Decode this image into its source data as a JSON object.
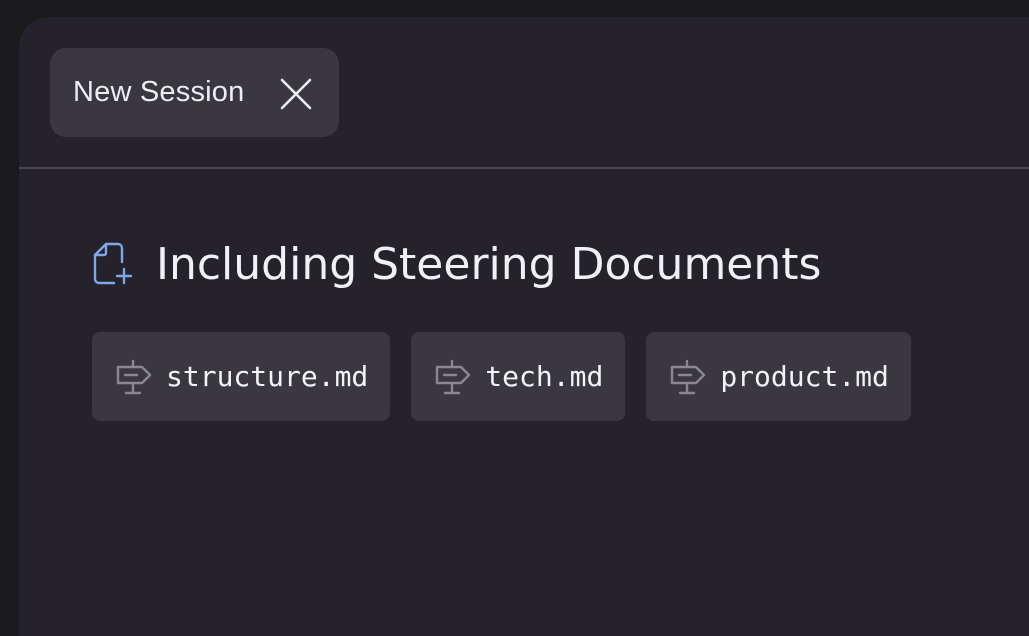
{
  "tab": {
    "label": "New Session",
    "close_icon": "close-icon"
  },
  "section": {
    "title": "Including Steering Documents",
    "icon": "file-add-icon",
    "icon_color": "#7ea8e8"
  },
  "documents": [
    {
      "label": "structure.md",
      "icon": "signpost-icon"
    },
    {
      "label": "tech.md",
      "icon": "signpost-icon"
    },
    {
      "label": "product.md",
      "icon": "signpost-icon"
    }
  ],
  "colors": {
    "background": "#1a1a1c",
    "panel": "#25222b",
    "chip": "#3a3740",
    "text": "#f1f0f4",
    "muted_icon": "#8a8790"
  }
}
